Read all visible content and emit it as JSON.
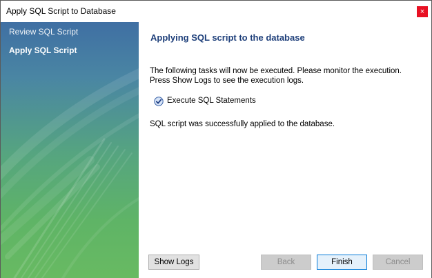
{
  "window": {
    "title": "Apply SQL Script to Database",
    "close_glyph": "×"
  },
  "sidebar": {
    "items": [
      {
        "label": "Review SQL Script",
        "active": false
      },
      {
        "label": "Apply SQL Script",
        "active": true
      }
    ]
  },
  "main": {
    "heading": "Applying SQL script to the database",
    "description_line1": "The following tasks will now be executed. Please monitor the execution.",
    "description_line2": "Press Show Logs to see the execution logs.",
    "task": {
      "label": "Execute SQL Statements",
      "status_icon": "check-circle-icon"
    },
    "result_message": "SQL script was successfully applied to the database."
  },
  "buttons": {
    "show_logs": "Show Logs",
    "back": "Back",
    "finish": "Finish",
    "cancel": "Cancel"
  },
  "colors": {
    "heading": "#1e3f7a",
    "sidebar_top": "#3f6fa3",
    "sidebar_bottom": "#68ba62",
    "close_button": "#e81123"
  }
}
